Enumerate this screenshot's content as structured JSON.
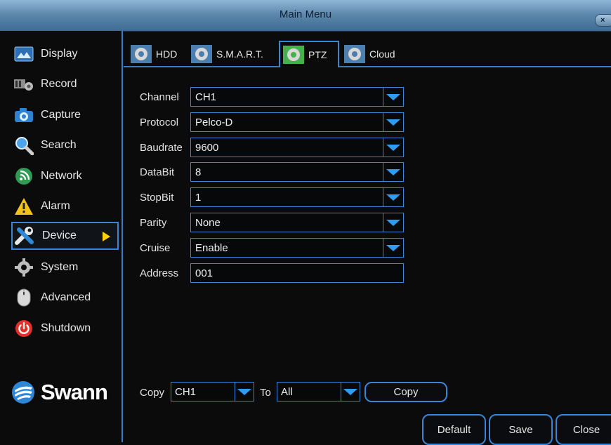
{
  "window": {
    "title": "Main Menu",
    "close_glyph": "×"
  },
  "sidebar": {
    "items": [
      {
        "label": "Display",
        "icon": "display-icon"
      },
      {
        "label": "Record",
        "icon": "record-icon"
      },
      {
        "label": "Capture",
        "icon": "camera-icon"
      },
      {
        "label": "Search",
        "icon": "search-icon"
      },
      {
        "label": "Network",
        "icon": "network-icon"
      },
      {
        "label": "Alarm",
        "icon": "alarm-icon"
      },
      {
        "label": "Device",
        "icon": "device-icon",
        "active": true
      },
      {
        "label": "System",
        "icon": "gear-icon"
      },
      {
        "label": "Advanced",
        "icon": "mouse-icon"
      },
      {
        "label": "Shutdown",
        "icon": "power-icon"
      }
    ],
    "brand": "Swann"
  },
  "tabs": [
    {
      "label": "HDD"
    },
    {
      "label": "S.M.A.R.T."
    },
    {
      "label": "PTZ",
      "active": true
    },
    {
      "label": "Cloud"
    }
  ],
  "ptz": {
    "fields": [
      {
        "label": "Channel",
        "value": "CH1",
        "type": "select"
      },
      {
        "label": "Protocol",
        "value": "Pelco-D",
        "type": "select"
      },
      {
        "label": "Baudrate",
        "value": "9600",
        "type": "select"
      },
      {
        "label": "DataBit",
        "value": "8",
        "type": "select"
      },
      {
        "label": "StopBit",
        "value": "1",
        "type": "select"
      },
      {
        "label": "Parity",
        "value": "None",
        "type": "select"
      },
      {
        "label": "Cruise",
        "value": "Enable",
        "type": "select"
      },
      {
        "label": "Address",
        "value": "001",
        "type": "input"
      }
    ]
  },
  "copy": {
    "label": "Copy",
    "from_value": "CH1",
    "to_label": "To",
    "to_value": "All",
    "button": "Copy"
  },
  "footer": {
    "default_label": "Default",
    "save_label": "Save",
    "close_label": "Close"
  },
  "colors": {
    "accent_blue": "#3a86d6",
    "titlebar": "#5e88ad",
    "arrow_yellow": "#ffd200",
    "background": "#0b0b0c"
  }
}
